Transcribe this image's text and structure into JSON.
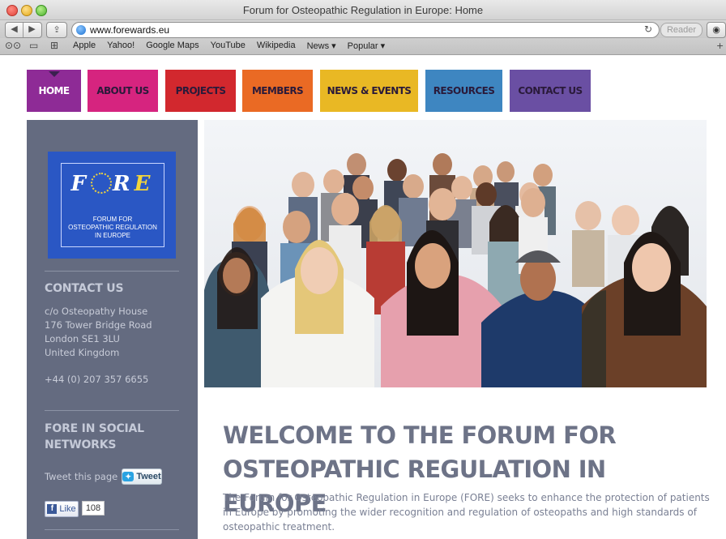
{
  "window": {
    "title": "Forum for Osteopathic Regulation in Europe: Home",
    "url": "www.forewards.eu",
    "reader_label": "Reader"
  },
  "bookmarks": [
    "Apple",
    "Yahoo!",
    "Google Maps",
    "YouTube",
    "Wikipedia",
    "News ▾",
    "Popular ▾"
  ],
  "nav": {
    "items": [
      {
        "label": "HOME",
        "color": "#8e2b96"
      },
      {
        "label": "ABOUT US",
        "color": "#d6247f"
      },
      {
        "label": "PROJECTS",
        "color": "#d2282e"
      },
      {
        "label": "MEMBERS",
        "color": "#ea6a24"
      },
      {
        "label": "NEWS & EVENTS",
        "color": "#e9b824"
      },
      {
        "label": "RESOURCES",
        "color": "#3e86c1"
      },
      {
        "label": "CONTACT US",
        "color": "#6a4fa3"
      }
    ],
    "active": "HOME"
  },
  "sidebar": {
    "logo": {
      "word": "FORE",
      "subtitle": "FORUM FOR\nOSTEOPATHIC REGULATION\nIN EUROPE"
    },
    "contact_heading": "CONTACT US",
    "address": [
      "c/o Osteopathy House",
      "176 Tower Bridge Road",
      "London SE1 3LU",
      "United Kingdom"
    ],
    "phone": "+44 (0) 207 357 6655",
    "social_heading_line1": "FORE IN SOCIAL",
    "social_heading_line2": "NETWORKS",
    "tweet_label": "Tweet this page",
    "tweet_button": "Tweet",
    "like_button": "Like",
    "like_count": "108"
  },
  "main": {
    "welcome_line1": "WELCOME TO THE FORUM FOR",
    "welcome_line2": "OSTEOPATHIC REGULATION IN EUROPE",
    "intro": "The Forum for Osteopathic Regulation in Europe (FORE) seeks to enhance the protection of patients in Europe by promoting the wider recognition and regulation of osteopaths and high standards of osteopathic treatment."
  }
}
